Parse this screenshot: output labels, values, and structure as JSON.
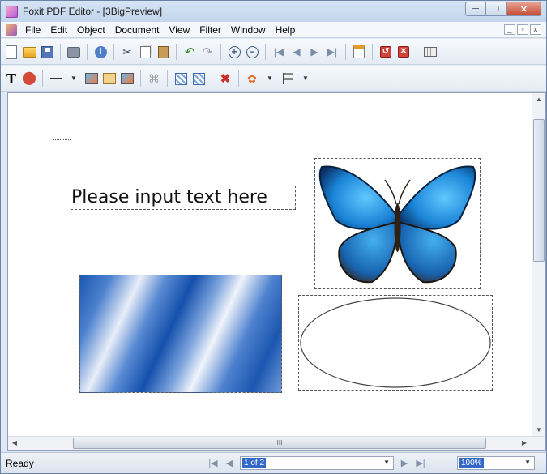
{
  "window": {
    "title": "Foxit PDF Editor - [3BigPreview]",
    "controls": {
      "minimize": "─",
      "maximize": "□",
      "close": "✕"
    }
  },
  "menubar": {
    "items": [
      "File",
      "Edit",
      "Object",
      "Document",
      "View",
      "Filter",
      "Window",
      "Help"
    ],
    "mdi": {
      "minimize": "_",
      "restore": "▫",
      "close": "x"
    }
  },
  "toolbar1": {
    "icons": [
      "new-document-icon",
      "open-folder-icon",
      "save-icon",
      "print-icon",
      "info-icon",
      "cut-icon",
      "copy-icon",
      "paste-icon",
      "undo-icon",
      "redo-icon",
      "zoom-in-icon",
      "zoom-out-icon",
      "first-page-icon",
      "previous-page-icon",
      "next-page-icon",
      "last-page-icon",
      "form-icon",
      "rotate-icon",
      "delete-page-icon",
      "keyboard-icon"
    ]
  },
  "toolbar2": {
    "icons": [
      "add-text-icon",
      "add-shape-icon",
      "line-icon",
      "insert-image-icon",
      "edit-object-icon",
      "add-image-icon",
      "disabled-icon",
      "group-icon",
      "ungroup-icon",
      "delete-object-icon",
      "color-icon",
      "align-icon"
    ]
  },
  "canvas": {
    "textbox_text": "Please input text here",
    "scroll_thumb_marker": "III"
  },
  "statusbar": {
    "status": "Ready",
    "page_indicator": "1 of 2",
    "zoom": "100%"
  }
}
